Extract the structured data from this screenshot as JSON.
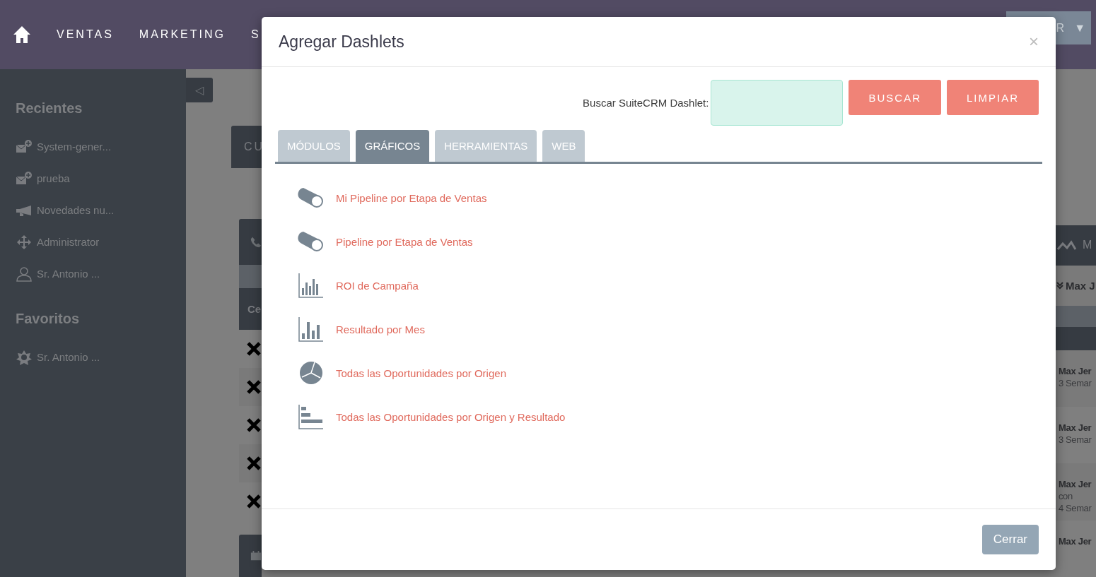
{
  "nav": {
    "items": [
      "VENTAS",
      "MARKETING",
      "S"
    ],
    "user_button": {
      "label": "R",
      "caret": "▼"
    }
  },
  "sidebar": {
    "collapse": "◁",
    "sections": [
      {
        "title": "Recientes",
        "items": [
          {
            "label": "System-gener...",
            "kind": "mail"
          },
          {
            "label": "prueba",
            "kind": "mail"
          },
          {
            "label": "Novedades nu...",
            "kind": "megaphone"
          },
          {
            "label": "Administrator",
            "kind": "move"
          },
          {
            "label": "Sr. Antonio ...",
            "kind": "person"
          }
        ]
      },
      {
        "title": "Favoritos",
        "items": [
          {
            "label": "Sr. Antonio ...",
            "kind": "star"
          }
        ]
      }
    ]
  },
  "background": {
    "left_header": "CU",
    "left_subheader": "Ce",
    "right_header": "M",
    "right_filter": "Max J",
    "right_entries": [
      {
        "name": "Max Jer",
        "lines": [
          "3 Semar"
        ]
      },
      {
        "name": "Max Jer",
        "lines": [
          "3 Semar"
        ]
      },
      {
        "name": "Max Jer",
        "lines": [
          "con",
          "4 Semar"
        ]
      },
      {
        "name": "Max Jer"
      }
    ]
  },
  "modal": {
    "title": "Agregar Dashlets",
    "close": "×",
    "search_label": "Buscar SuiteCRM Dashlet:",
    "buttons": [
      "BUSCAR",
      "LIMPIAR"
    ],
    "tabs": [
      {
        "label": "MÓDULOS",
        "selected": false
      },
      {
        "label": "GRÁFICOS",
        "selected": true
      },
      {
        "label": "HERRAMIENTAS",
        "selected": false
      },
      {
        "label": "WEB",
        "selected": false
      }
    ],
    "dashlets": [
      {
        "label": "Mi Pipeline por Etapa de Ventas",
        "kind": "pipeline"
      },
      {
        "label": "Pipeline por Etapa de Ventas",
        "kind": "pipeline"
      },
      {
        "label": "ROI de Campaña",
        "kind": "columns"
      },
      {
        "label": "Resultado por Mes",
        "kind": "monthly"
      },
      {
        "label": "Todas las Oportunidades por Origen",
        "kind": "pie"
      },
      {
        "label": "Todas las Oportunidades por Origen y Resultado",
        "kind": "hbar"
      }
    ],
    "close_button": "Cerrar"
  }
}
